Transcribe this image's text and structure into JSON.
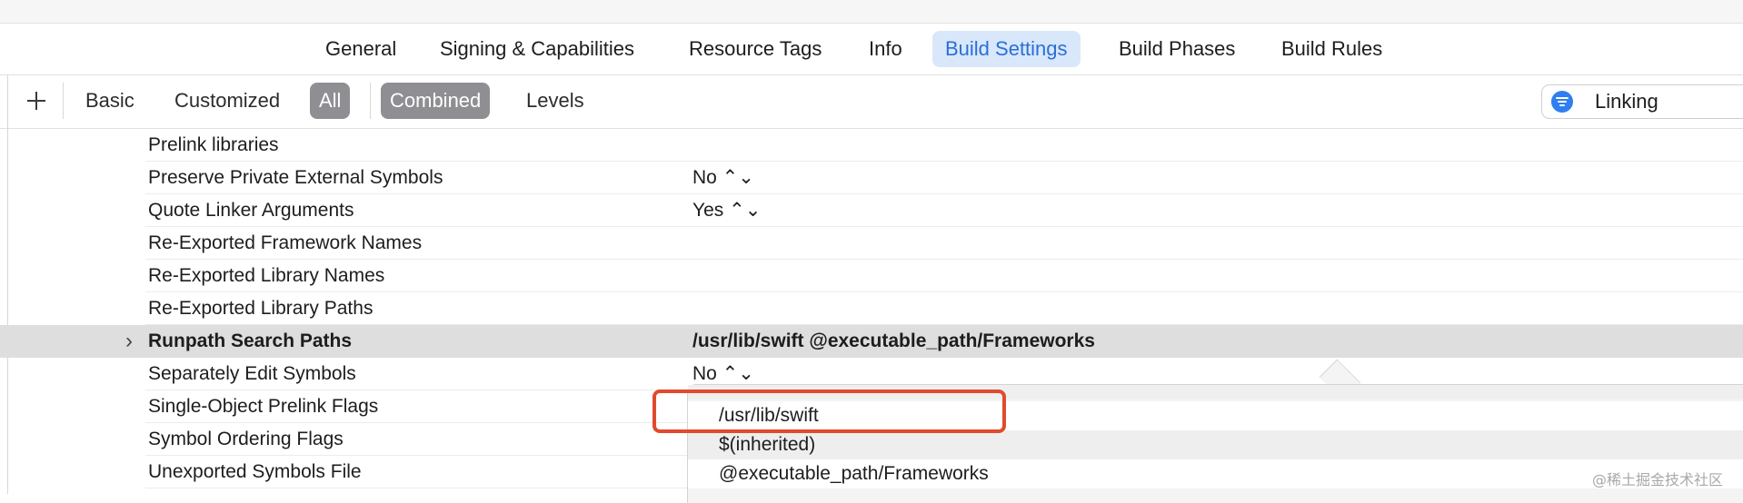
{
  "tabs": [
    "General",
    "Signing & Capabilities",
    "Resource Tags",
    "Info",
    "Build Settings",
    "Build Phases",
    "Build Rules"
  ],
  "active_tab": "Build Settings",
  "filters": {
    "add_label": "+",
    "basic": "Basic",
    "customized": "Customized",
    "all": "All",
    "combined": "Combined",
    "levels": "Levels"
  },
  "search": {
    "value": "Linking"
  },
  "settings_rows": [
    {
      "name": "Prelink libraries",
      "value": ""
    },
    {
      "name": "Preserve Private External Symbols",
      "value": "No ⌃⌄"
    },
    {
      "name": "Quote Linker Arguments",
      "value": "Yes ⌃⌄"
    },
    {
      "name": "Re-Exported Framework Names",
      "value": ""
    },
    {
      "name": "Re-Exported Library Names",
      "value": ""
    },
    {
      "name": "Re-Exported Library Paths",
      "value": ""
    },
    {
      "name": "Runpath Search Paths",
      "value": "/usr/lib/swift  @executable_path/Frameworks"
    },
    {
      "name": "Separately Edit Symbols",
      "value": "No ⌃⌄"
    },
    {
      "name": "Single-Object Prelink Flags",
      "value": ""
    },
    {
      "name": "Symbol Ordering Flags",
      "value": ""
    },
    {
      "name": "Unexported Symbols File",
      "value": ""
    }
  ],
  "popover_items": [
    "/usr/lib/swift",
    "$(inherited)",
    "@executable_path/Frameworks"
  ],
  "watermark": "@稀土掘金技术社区",
  "colors": {
    "accent": "#2a6fd6",
    "tab_active_bg": "#d9e7fb",
    "highlight_box": "#e14a2d",
    "selected_filter": "#8e8e93"
  }
}
